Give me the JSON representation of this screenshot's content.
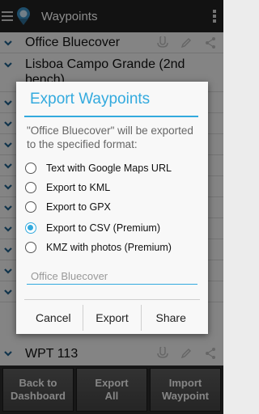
{
  "actionbar": {
    "title": "Waypoints"
  },
  "list": {
    "rows": [
      {
        "name": "Office Bluecover"
      },
      {
        "name": "Lisboa Campo Grande (2nd bench)"
      },
      {
        "name": ""
      },
      {
        "name": ""
      },
      {
        "name": ""
      },
      {
        "name": ""
      },
      {
        "name": ""
      },
      {
        "name": ""
      },
      {
        "name": ""
      },
      {
        "name": ""
      },
      {
        "name": ""
      },
      {
        "name": ""
      },
      {
        "name": "WPT 113"
      }
    ]
  },
  "bottom_buttons": {
    "back": "Back to\nDashboard",
    "export_all": "Export\nAll",
    "import": "Import\nWaypoint"
  },
  "dialog": {
    "title": "Export Waypoints",
    "message": "\"Office Bluecover\" will be exported to the specified format:",
    "options": [
      {
        "label": "Text with Google Maps URL",
        "checked": false
      },
      {
        "label": "Export to KML",
        "checked": false
      },
      {
        "label": "Export to GPX",
        "checked": false
      },
      {
        "label": "Export to CSV (Premium)",
        "checked": true
      },
      {
        "label": "KMZ with photos (Premium)",
        "checked": false
      }
    ],
    "name_field": {
      "value": "",
      "placeholder": "Office Bluecover"
    },
    "buttons": {
      "cancel": "Cancel",
      "export": "Export",
      "share": "Share"
    }
  },
  "colors": {
    "accent": "#33aade",
    "actionbar": "#222222"
  }
}
